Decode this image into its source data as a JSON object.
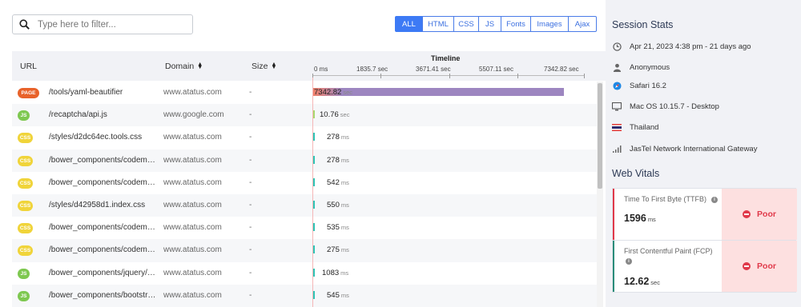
{
  "search": {
    "placeholder": "Type here to filter..."
  },
  "filters": [
    "ALL",
    "HTML",
    "CSS",
    "JS",
    "Fonts",
    "Images",
    "Ajax"
  ],
  "columns": {
    "url": "URL",
    "domain": "Domain",
    "size": "Size",
    "timeline": "Timeline"
  },
  "ticks": [
    "0 ms",
    "1835.7 sec",
    "3671.41 sec",
    "5507.11 sec",
    "7342.82 sec"
  ],
  "rows": [
    {
      "type": "PAGE",
      "url": "/tools/yaml-beautifier",
      "domain": "www.atatus.com",
      "size": "-",
      "duration": "7342.82",
      "unit": "sec",
      "bar_color": "#9d86c0"
    },
    {
      "type": "JS",
      "url": "/recaptcha/api.js",
      "domain": "www.google.com",
      "size": "-",
      "duration": "10.76",
      "unit": "sec",
      "bar_color": "#a8d86e"
    },
    {
      "type": "CSS",
      "url": "/styles/d2dc64ec.tools.css",
      "domain": "www.atatus.com",
      "size": "-",
      "duration": "278",
      "unit": "ms",
      "bar_color": "#2ec4b6"
    },
    {
      "type": "CSS",
      "url": "/bower_components/codemirror/lib/codemirror.css",
      "domain": "www.atatus.com",
      "size": "-",
      "duration": "278",
      "unit": "ms",
      "bar_color": "#2ec4b6"
    },
    {
      "type": "CSS",
      "url": "/bower_components/codemirror/theme/monokai.css",
      "domain": "www.atatus.com",
      "size": "-",
      "duration": "542",
      "unit": "ms",
      "bar_color": "#2ec4b6"
    },
    {
      "type": "CSS",
      "url": "/styles/d42958d1.index.css",
      "domain": "www.atatus.com",
      "size": "-",
      "duration": "550",
      "unit": "ms",
      "bar_color": "#2ec4b6"
    },
    {
      "type": "CSS",
      "url": "/bower_components/codemirror/addon/fold/foldgutter.css",
      "domain": "www.atatus.com",
      "size": "-",
      "duration": "535",
      "unit": "ms",
      "bar_color": "#2ec4b6"
    },
    {
      "type": "CSS",
      "url": "/bower_components/codemirror/addon/lint/lint.css",
      "domain": "www.atatus.com",
      "size": "-",
      "duration": "275",
      "unit": "ms",
      "bar_color": "#2ec4b6"
    },
    {
      "type": "JS",
      "url": "/bower_components/jquery/dist/jquery.min.js",
      "domain": "www.atatus.com",
      "size": "-",
      "duration": "1083",
      "unit": "ms",
      "bar_color": "#2ec4b6"
    },
    {
      "type": "JS",
      "url": "/bower_components/bootstrap/dist/js/bootstrap.min.js",
      "domain": "www.atatus.com",
      "size": "-",
      "duration": "545",
      "unit": "ms",
      "bar_color": "#2ec4b6"
    }
  ],
  "session": {
    "title": "Session Stats",
    "date": "Apr 21, 2023 4:38 pm - 21 days ago",
    "user": "Anonymous",
    "browser": "Safari 16.2",
    "os": "Mac OS 10.15.7 - Desktop",
    "country": "Thailand",
    "isp": "JasTel Network International Gateway"
  },
  "vitals": {
    "title": "Web Vitals",
    "items": [
      {
        "label": "Time To First Byte (TTFB)",
        "value": "1596",
        "unit": "ms",
        "status": "Poor",
        "color": "#e0394a"
      },
      {
        "label": "First Contentful Paint (FCP)",
        "value": "12.62",
        "unit": "sec",
        "status": "Poor",
        "color": "#2a8c7a"
      }
    ]
  }
}
